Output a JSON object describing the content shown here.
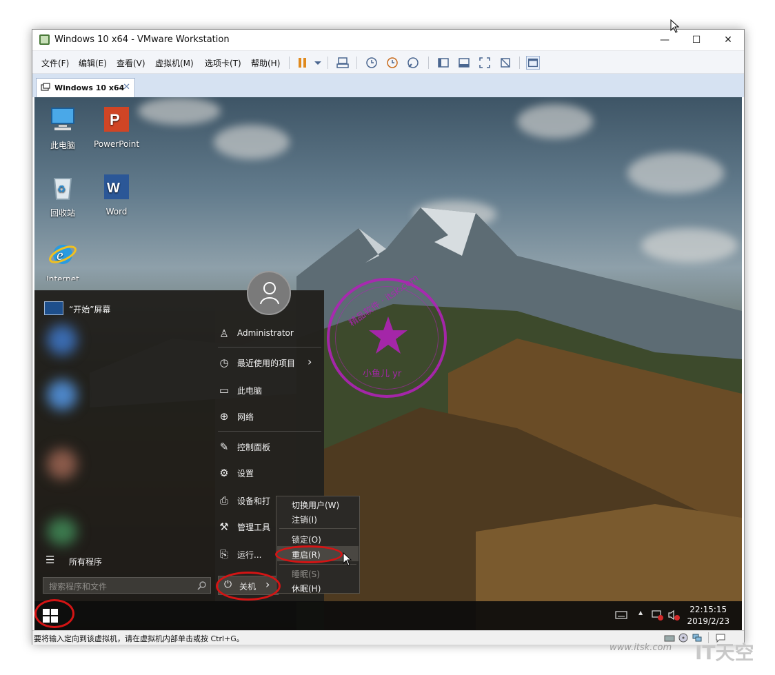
{
  "window": {
    "title": "Windows 10 x64 - VMware Workstation",
    "minimize": "—",
    "maximize": "☐",
    "close": "✕"
  },
  "menubar": {
    "items": [
      "文件(F)",
      "编辑(E)",
      "查看(V)",
      "虚拟机(M)",
      "选项卡(T)",
      "帮助(H)"
    ]
  },
  "tab": {
    "label": "Windows 10 x64",
    "close": "✕"
  },
  "desktop": {
    "icons": [
      "此电脑",
      "PowerPoint",
      "回收站",
      "Word",
      "Internet Explorer"
    ]
  },
  "start_menu": {
    "tile_label": "“开始”屏幕",
    "user": "Administrator",
    "items": [
      "最近使用的项目",
      "此电脑",
      "网络",
      "控制面板",
      "设置",
      "设备和打",
      "管理工具",
      "运行..."
    ],
    "all_programs": "所有程序",
    "search_placeholder": "搜索程序和文件",
    "shutdown_label": "关机",
    "chevron": "›"
  },
  "context_menu": {
    "items": [
      "切换用户(W)",
      "注销(I)",
      "锁定(O)",
      "重启(R)",
      "睡眠(S)",
      "休眠(H)"
    ],
    "highlighted": "重启(R)",
    "disabled": "睡眠(S)"
  },
  "taskbar": {
    "time": "22:15:15",
    "date": "2019/2/23",
    "tray_up": "▲"
  },
  "stamp": {
    "top_text": "精品软件 · itsk.com",
    "bottom_text": "小鱼儿 yr"
  },
  "statusbar": {
    "message": "要将输入定向到该虚拟机，请在虚拟机内部单击或按 Ctrl+G。"
  },
  "watermark": {
    "small": "www.itsk.com",
    "big": "IT天空"
  },
  "colors": {
    "accent_red": "#d41414",
    "stamp": "#b023b6",
    "tab_bg": "#d6e2f2"
  }
}
